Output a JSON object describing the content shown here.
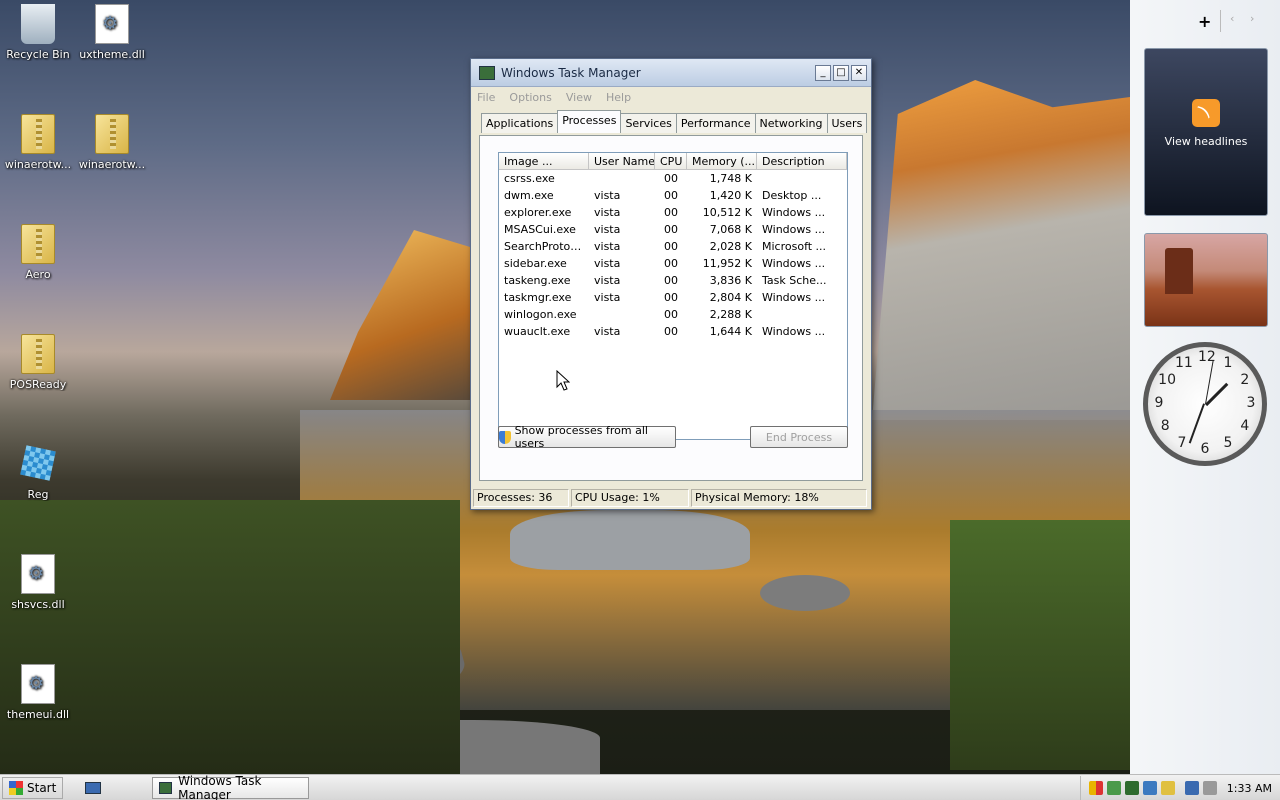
{
  "desktop": {
    "icons": [
      {
        "label": "Recycle Bin"
      },
      {
        "label": "uxtheme.dll"
      },
      {
        "label": "winaerotw..."
      },
      {
        "label": "winaerotw..."
      },
      {
        "label": "Aero"
      },
      {
        "label": "POSReady"
      },
      {
        "label": "Reg"
      },
      {
        "label": "shsvcs.dll"
      },
      {
        "label": "themeui.dll"
      }
    ]
  },
  "window": {
    "title": "Windows Task Manager",
    "minimize": "_",
    "maximize": "□",
    "close": "✕",
    "menu": [
      "File",
      "Options",
      "View",
      "Help"
    ],
    "tabs": [
      "Applications",
      "Processes",
      "Services",
      "Performance",
      "Networking",
      "Users"
    ],
    "active_tab": "Processes",
    "columns": [
      "Image ...",
      "User Name",
      "CPU",
      "Memory (...",
      "Description"
    ],
    "processes": [
      {
        "image": "csrss.exe",
        "user": "",
        "cpu": "00",
        "memory": "1,748 K",
        "desc": ""
      },
      {
        "image": "dwm.exe",
        "user": "vista",
        "cpu": "00",
        "memory": "1,420 K",
        "desc": "Desktop ..."
      },
      {
        "image": "explorer.exe",
        "user": "vista",
        "cpu": "00",
        "memory": "10,512 K",
        "desc": "Windows ..."
      },
      {
        "image": "MSASCui.exe",
        "user": "vista",
        "cpu": "00",
        "memory": "7,068 K",
        "desc": "Windows ..."
      },
      {
        "image": "SearchProtoco...",
        "user": "vista",
        "cpu": "00",
        "memory": "2,028 K",
        "desc": "Microsoft ..."
      },
      {
        "image": "sidebar.exe",
        "user": "vista",
        "cpu": "00",
        "memory": "11,952 K",
        "desc": "Windows ..."
      },
      {
        "image": "taskeng.exe",
        "user": "vista",
        "cpu": "00",
        "memory": "3,836 K",
        "desc": "Task Sche..."
      },
      {
        "image": "taskmgr.exe",
        "user": "vista",
        "cpu": "00",
        "memory": "2,804 K",
        "desc": "Windows ..."
      },
      {
        "image": "winlogon.exe",
        "user": "",
        "cpu": "00",
        "memory": "2,288 K",
        "desc": ""
      },
      {
        "image": "wuauclt.exe",
        "user": "vista",
        "cpu": "00",
        "memory": "1,644 K",
        "desc": "Windows ..."
      }
    ],
    "show_all_button": "Show processes from all users",
    "end_process_button": "End Process",
    "status": {
      "processes": "Processes: 36",
      "cpu": "CPU Usage: 1%",
      "memory": "Physical Memory: 18%"
    }
  },
  "sidebar": {
    "add": "+",
    "feeds_label": "View headlines"
  },
  "clock": {
    "numbers": [
      "12",
      "1",
      "2",
      "3",
      "4",
      "5",
      "6",
      "7",
      "8",
      "9",
      "10",
      "11"
    ]
  },
  "taskbar": {
    "start_label": "Start",
    "task_label": "Windows Task Manager",
    "time": "1:33 AM"
  }
}
